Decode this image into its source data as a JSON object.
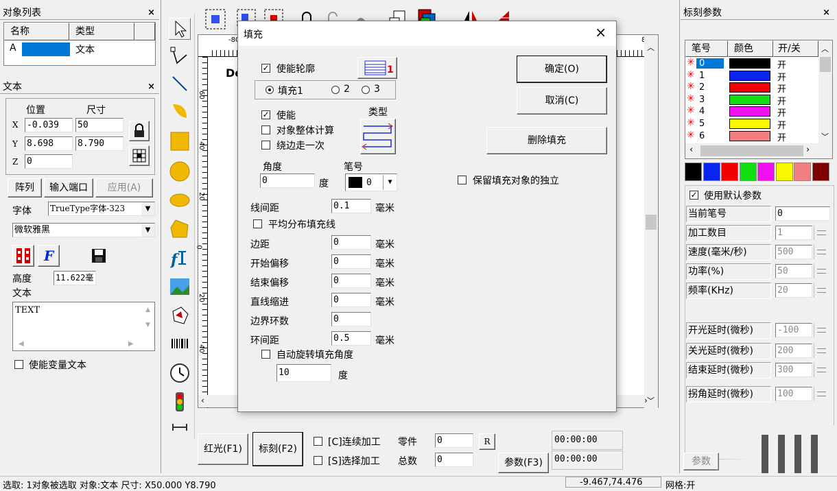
{
  "object_list": {
    "title": "对象列表",
    "close": "×",
    "col_name": "名称",
    "col_type": "类型",
    "rows": [
      {
        "name": "A",
        "type": "文本"
      }
    ]
  },
  "text_panel": {
    "title": "文本",
    "close": "×",
    "pos_label": "位置",
    "size_label": "尺寸",
    "x_label": "X",
    "y_label": "Y",
    "z_label": "Z",
    "x_pos": "-0.039",
    "y_pos": "8.698",
    "z_pos": "0",
    "x_size": "50",
    "y_size": "8.790",
    "array_btn": "阵列",
    "input_port_btn": "输入端口",
    "apply_btn": "应用(A)",
    "font_label": "字体",
    "font_type": "TrueType字体-323",
    "font_name": "微软雅黑",
    "height_label": "高度",
    "height_value": "11.622毫",
    "text_label": "文本",
    "text_value": "TEXT",
    "variable_text": "使能变量文本"
  },
  "dialog": {
    "title": "填充",
    "close": "×",
    "enable_outline": "使能轮廓",
    "fill1": "填充1",
    "fill2": "2",
    "fill3": "3",
    "enable": "使能",
    "type_label": "类型",
    "whole_calc": "对象整体计算",
    "edge_once": "绕边走一次",
    "angle_label": "角度",
    "angle_value": "0",
    "angle_unit": "度",
    "pen_label": "笔号",
    "pen_value": "0",
    "line_spacing_label": "线间距",
    "line_spacing_value": "0.1",
    "mm": "毫米",
    "avg_distribute": "平均分布填充线",
    "margin_label": "边距",
    "margin_value": "0",
    "start_offset_label": "开始偏移",
    "start_offset_value": "0",
    "end_offset_label": "结束偏移",
    "end_offset_value": "0",
    "line_indent_label": "直线缩进",
    "line_indent_value": "0",
    "loop_count_label": "边界环数",
    "loop_count_value": "0",
    "loop_spacing_label": "环间距",
    "loop_spacing_value": "0.5",
    "auto_rotate": "自动旋转填充角度",
    "rotate_value": "10",
    "rotate_unit": "度",
    "ok_btn": "确定(O)",
    "cancel_btn": "取消(C)",
    "delete_btn": "删除填充",
    "keep_independent": "保留填充对象的独立"
  },
  "canvas": {
    "ruler_left_num": "-80",
    "ruler_right_num": "80",
    "partial_text": "De",
    "v_ticks": [
      "60",
      "40",
      "20",
      "0",
      "20",
      "40",
      "60"
    ]
  },
  "marking": {
    "title": "标刻参数",
    "close": "×",
    "col_pen": "笔号",
    "col_color": "颜色",
    "col_onoff": "开/关",
    "pens": [
      {
        "num": "0",
        "color": "#000000",
        "state": "开"
      },
      {
        "num": "1",
        "color": "#0a24f0",
        "state": "开"
      },
      {
        "num": "2",
        "color": "#f00000",
        "state": "开"
      },
      {
        "num": "3",
        "color": "#10e010",
        "state": "开"
      },
      {
        "num": "4",
        "color": "#f010f0",
        "state": "开"
      },
      {
        "num": "5",
        "color": "#f8f800",
        "state": "开"
      },
      {
        "num": "6",
        "color": "#f08080",
        "state": "开"
      }
    ],
    "palette": [
      "#000000",
      "#0a24f0",
      "#f00000",
      "#10e010",
      "#f010f0",
      "#f8f800",
      "#f08080",
      "#800000"
    ],
    "use_default": "使用默认参数",
    "current_pen_label": "当前笔号",
    "current_pen_value": "0",
    "count_label": "加工数目",
    "count_value": "1",
    "speed_label": "速度(毫米/秒)",
    "speed_value": "500",
    "power_label": "功率(%)",
    "power_value": "50",
    "freq_label": "频率(KHz)",
    "freq_value": "20",
    "on_delay_label": "开光延时(微秒)",
    "on_delay_value": "-100",
    "off_delay_label": "关光延时(微秒)",
    "off_delay_value": "200",
    "end_delay_label": "结束延时(微秒)",
    "end_delay_value": "300",
    "corner_delay_label": "拐角延时(微秒)",
    "corner_delay_value": "100",
    "param_btn": "参数"
  },
  "bottom": {
    "red_light": "红光(F1)",
    "mark": "标刻(F2)",
    "continuous": "[C]连续加工",
    "select_process": "[S]选择加工",
    "parts_label": "零件",
    "parts_value": "0",
    "total_label": "总数",
    "total_value": "0",
    "r_btn": "R",
    "params_btn": "参数(F3)",
    "time1": "00:00:00",
    "time2": "00:00:00"
  },
  "status": {
    "text": "选取: 1对象被选取 对象:文本 尺寸: X50.000 Y8.790",
    "coords": "-9.467,74.476",
    "grid": "网格:开"
  }
}
